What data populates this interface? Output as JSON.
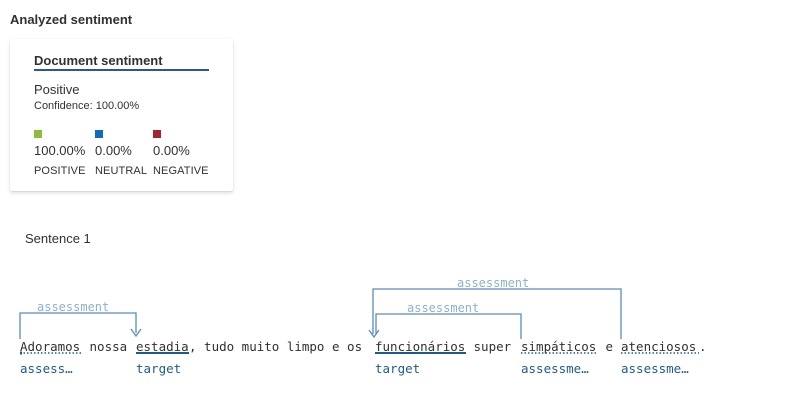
{
  "header": {
    "title": "Analyzed sentiment"
  },
  "card": {
    "title": "Document sentiment",
    "overall": "Positive",
    "confidence": "Confidence: 100.00%",
    "scores": [
      {
        "pct": "100.00%",
        "label": "POSITIVE",
        "color": "#8cbd3b"
      },
      {
        "pct": "0.00%",
        "label": "NEUTRAL",
        "color": "#0f6cbd"
      },
      {
        "pct": "0.00%",
        "label": "NEGATIVE",
        "color": "#a4262c"
      }
    ],
    "underline_color": "#2b579a"
  },
  "sentence": {
    "label": "Sentence 1",
    "tokens": [
      "Adoramos",
      " nossa ",
      "estadia",
      ", tudo muito limpo e os ",
      "funcionários",
      " super ",
      "simpáticos",
      " e ",
      "atenciosos",
      "."
    ],
    "tags": [
      "assess…",
      "target",
      "target",
      "assessme…",
      "assessme…"
    ],
    "relations": [
      "assessment",
      "assessment",
      "assessment"
    ]
  },
  "colors": {
    "relation_line": "#5a8cc0",
    "relation_text": "#8fb0cf",
    "tag_text": "#1f5a8f"
  }
}
